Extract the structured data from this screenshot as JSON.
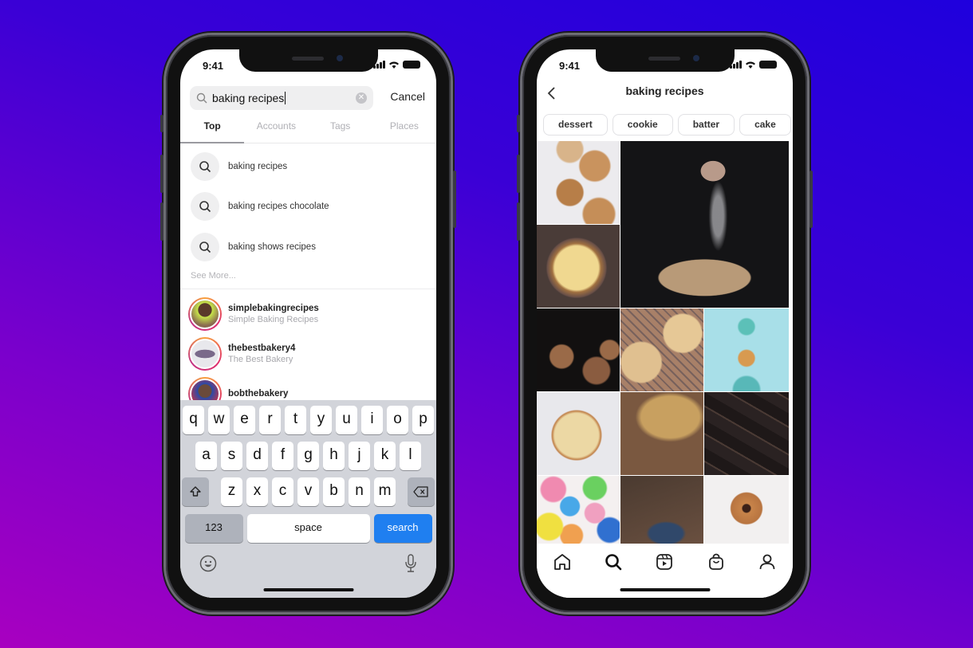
{
  "background": {
    "gradient_from": "#1f00dd",
    "gradient_to": "#a800c0"
  },
  "left_phone": {
    "status": {
      "time": "9:41"
    },
    "search": {
      "query": "baking recipes",
      "cancel_label": "Cancel"
    },
    "tabs": [
      {
        "label": "Top",
        "active": true
      },
      {
        "label": "Accounts",
        "active": false
      },
      {
        "label": "Tags",
        "active": false
      },
      {
        "label": "Places",
        "active": false
      }
    ],
    "suggestions": [
      {
        "text": "baking recipes"
      },
      {
        "text": "baking recipes chocolate"
      },
      {
        "text": "baking shows recipes"
      }
    ],
    "see_more": "See More...",
    "accounts": [
      {
        "username": "simplebakingrecipes",
        "name": "Simple Baking Recipes"
      },
      {
        "username": "thebestbakery4",
        "name": "The Best Bakery"
      },
      {
        "username": "bobthebakery",
        "name": ""
      }
    ],
    "keyboard": {
      "row1": [
        "q",
        "w",
        "e",
        "r",
        "t",
        "y",
        "u",
        "i",
        "o",
        "p"
      ],
      "row2": [
        "a",
        "s",
        "d",
        "f",
        "g",
        "h",
        "j",
        "k",
        "l"
      ],
      "row3": [
        "z",
        "x",
        "c",
        "v",
        "b",
        "n",
        "m"
      ],
      "numbers_label": "123",
      "space_label": "space",
      "search_label": "search",
      "search_color": "#1f7ff0"
    }
  },
  "right_phone": {
    "status": {
      "time": "9:41"
    },
    "header_title": "baking recipes",
    "chips": [
      "dessert",
      "cookie",
      "batter",
      "cake"
    ],
    "grid_tiles": [
      {
        "subject": "mini lattice pies on marble"
      },
      {
        "subject": "sifting powdered sugar over apple tart"
      },
      {
        "subject": "lattice pie on dark wood"
      },
      {
        "subject": "muffins on dark background"
      },
      {
        "subject": "blueberry lattice tarts"
      },
      {
        "subject": "macarons on light blue"
      },
      {
        "subject": "apple pie top view"
      },
      {
        "subject": "crumble dessert with spoon"
      },
      {
        "subject": "chocolate chunks"
      },
      {
        "subject": "colorful donuts"
      },
      {
        "subject": "serving blueberry pie"
      },
      {
        "subject": "glazed donut with bite"
      }
    ],
    "nav": [
      "home",
      "search",
      "reels",
      "shop",
      "profile"
    ]
  }
}
